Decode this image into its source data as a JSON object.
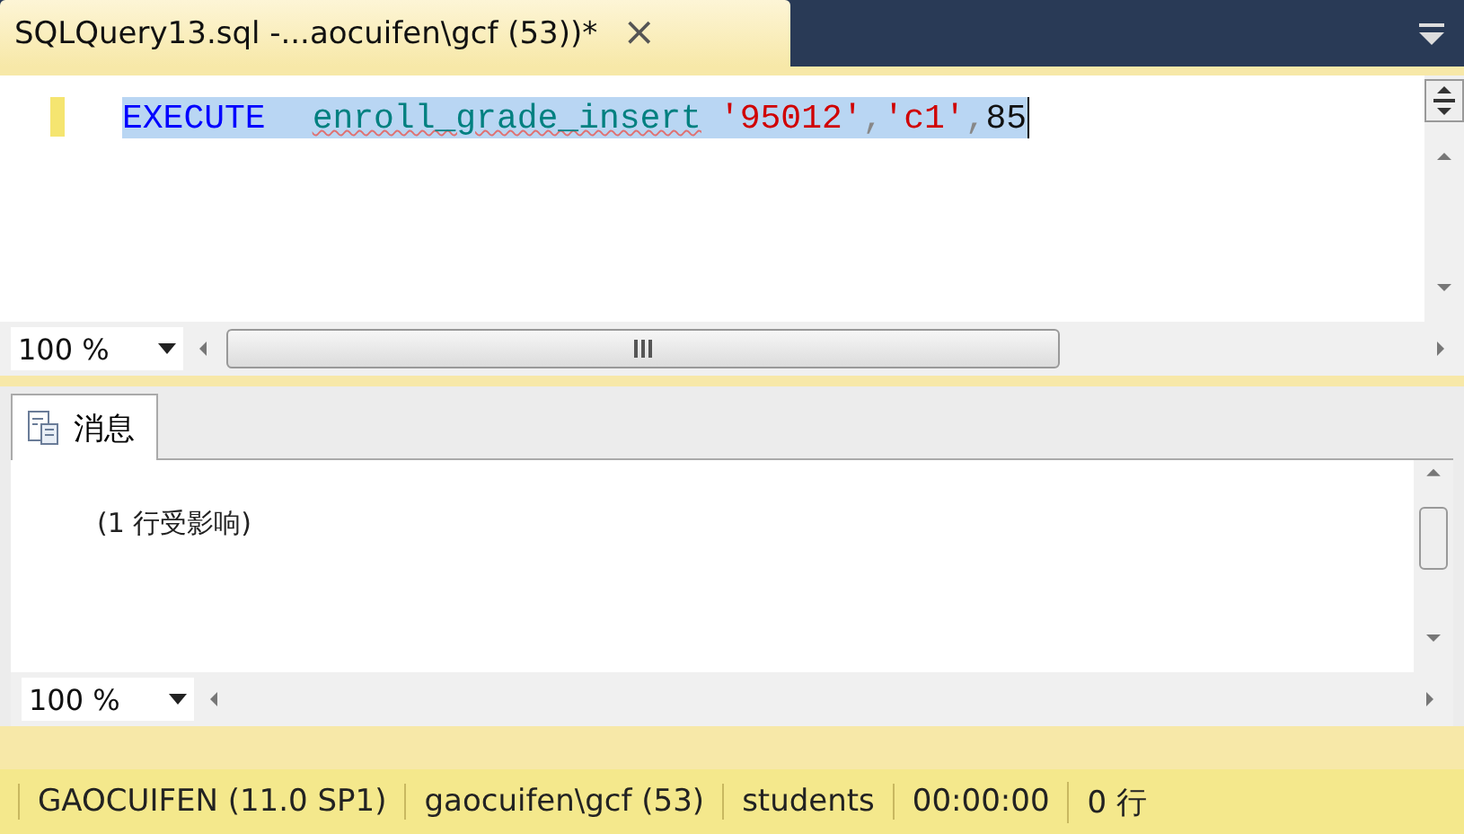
{
  "document_tab": {
    "title": "SQLQuery13.sql -...aocuifen\\gcf (53))*",
    "close": "×",
    "selected": true
  },
  "editor": {
    "code": [
      {
        "kind": "keyword",
        "text": "EXECUTE"
      },
      {
        "kind": "proc",
        "text": "enroll_grade_insert"
      },
      {
        "kind": "string",
        "text": "'95012'"
      },
      {
        "kind": "punct",
        "text": ","
      },
      {
        "kind": "string",
        "text": "'c1'"
      },
      {
        "kind": "punct",
        "text": ","
      },
      {
        "kind": "number",
        "text": "85"
      }
    ],
    "selected": true,
    "zoom": "100 %"
  },
  "results": {
    "tabs": [
      {
        "label": "消息",
        "selected": true
      }
    ],
    "message": "(1  行受影响)",
    "zoom": "100 %"
  },
  "status_bar": [
    "GAOCUIFEN (11.0 SP1)",
    "gaocuifen\\gcf (53)",
    "students",
    "00:00:00",
    "0 行"
  ]
}
